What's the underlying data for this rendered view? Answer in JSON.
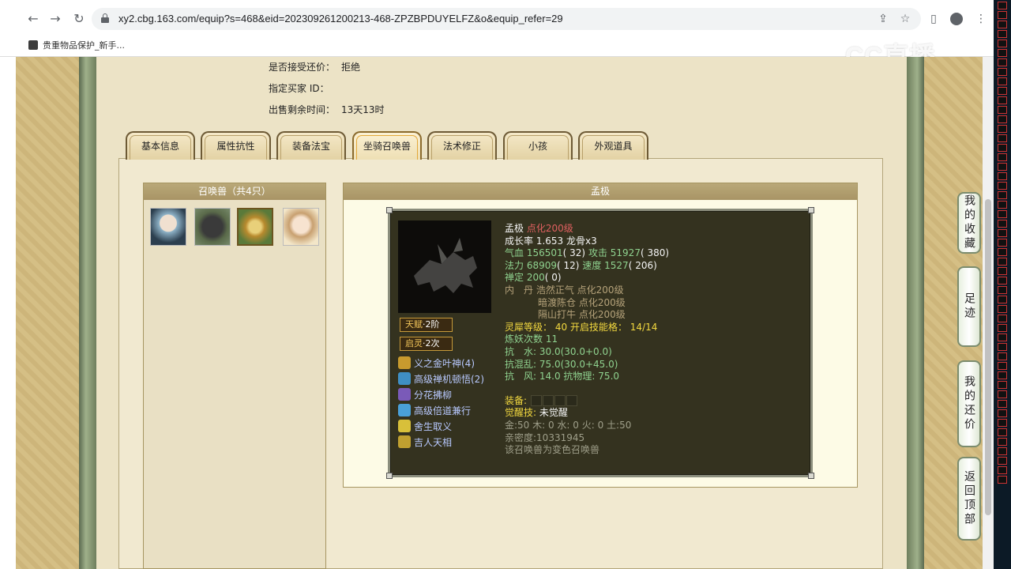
{
  "browser": {
    "url": "xy2.cbg.163.com/equip?s=468&eid=202309261200213-468-ZPZBPDUYELFZ&o&equip_refer=29",
    "bookmark": "贵重物品保护_新手...",
    "watermark": "CC直播"
  },
  "listing": {
    "accept_counter_label": "是否接受还价：",
    "accept_counter_value": "拒绝",
    "buyer_id_label": "指定买家 ID：",
    "buyer_id_value": "",
    "time_left_label": "出售剩余时间：",
    "time_left_value": "13天13时"
  },
  "tabs": [
    "基本信息",
    "属性抗性",
    "装备法宝",
    "坐骑召唤兽",
    "法术修正",
    "小孩",
    "外观道具"
  ],
  "active_tab": 3,
  "pets_panel": {
    "title": "召唤兽（共4只）"
  },
  "detail_panel": {
    "title": "孟极"
  },
  "pet": {
    "name": "孟极",
    "level": "点化200级",
    "growth": "成长率 1.653 龙骨x3",
    "hp_label": "气血",
    "hp": "156501",
    "hp_extra": "( 32)",
    "atk_label": "攻击",
    "atk": "51927",
    "atk_extra": "( 380)",
    "mp_label": "法力",
    "mp": "68909",
    "mp_extra": "( 12)",
    "spd_label": "速度",
    "spd": "1527",
    "spd_extra": "( 206)",
    "zen_label": "禅定",
    "zen": "200",
    "zen_extra": "( 0)",
    "neidan_label": "内　丹",
    "neidan": [
      "浩然正气 点化200级",
      "暗渡陈仓 点化200级",
      "隔山打牛 点化200级"
    ],
    "spirit_label": "灵犀等级：",
    "spirit_value": "40",
    "skill_count_label": "开启技能格：",
    "skill_count_value": "14/14",
    "refine_label": "炼妖次数",
    "refine_value": "11",
    "res_water_label": "抗　水:",
    "res_water": "30.0(30.0+0.0)",
    "res_chaos_label": "抗混乱:",
    "res_chaos": "75.0(30.0+45.0)",
    "res_wind_label": "抗　风:",
    "res_wind": "14.0",
    "res_phys_label": "抗物理:",
    "res_phys": "75.0",
    "equip_label": "装备:",
    "awaken_label": "觉醒技:",
    "awaken_value": "未觉醒",
    "elements": "金:50 木: 0 水: 0 火: 0 土:50",
    "intimacy": "亲密度:10331945",
    "note": "该召唤兽为变色召唤兽"
  },
  "badges": [
    {
      "label": "天赋",
      "value": "·2阶"
    },
    {
      "label": "启灵",
      "value": "·2次"
    }
  ],
  "skills": [
    {
      "name": "义之金叶神(4)",
      "icon": "gold-leaf-icon",
      "color": "#c79a2e"
    },
    {
      "name": "高级禅机顿悟(2)",
      "icon": "zen-insight-icon",
      "color": "#3f8fc4"
    },
    {
      "name": "分花拂柳",
      "icon": "flower-willow-icon",
      "color": "#7a5ab8"
    },
    {
      "name": "高级倍道兼行",
      "icon": "swift-march-icon",
      "color": "#4aa0d8"
    },
    {
      "name": "舍生取义",
      "icon": "sacrifice-icon",
      "color": "#d8c03a"
    },
    {
      "name": "吉人天相",
      "icon": "fortune-icon",
      "color": "#c0a030"
    }
  ],
  "float_buttons": [
    "我的收藏",
    "足迹",
    "我的还价",
    "返回顶部"
  ]
}
